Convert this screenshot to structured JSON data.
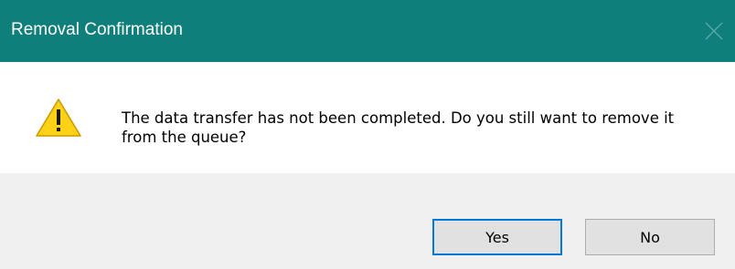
{
  "window": {
    "title": "Removal Confirmation"
  },
  "message": {
    "icon": "warning-icon",
    "text": "The data transfer has not been completed. Do you still want to remove it from the queue?"
  },
  "buttons": {
    "yes_label": "Yes",
    "no_label": "No",
    "default": "Yes"
  },
  "colors": {
    "titlebar": "#0f7f7b",
    "footer": "#f0f0f0",
    "button_face": "#e1e1e1",
    "focus_border": "#0078d7",
    "warning_fill": "#fcd116"
  }
}
